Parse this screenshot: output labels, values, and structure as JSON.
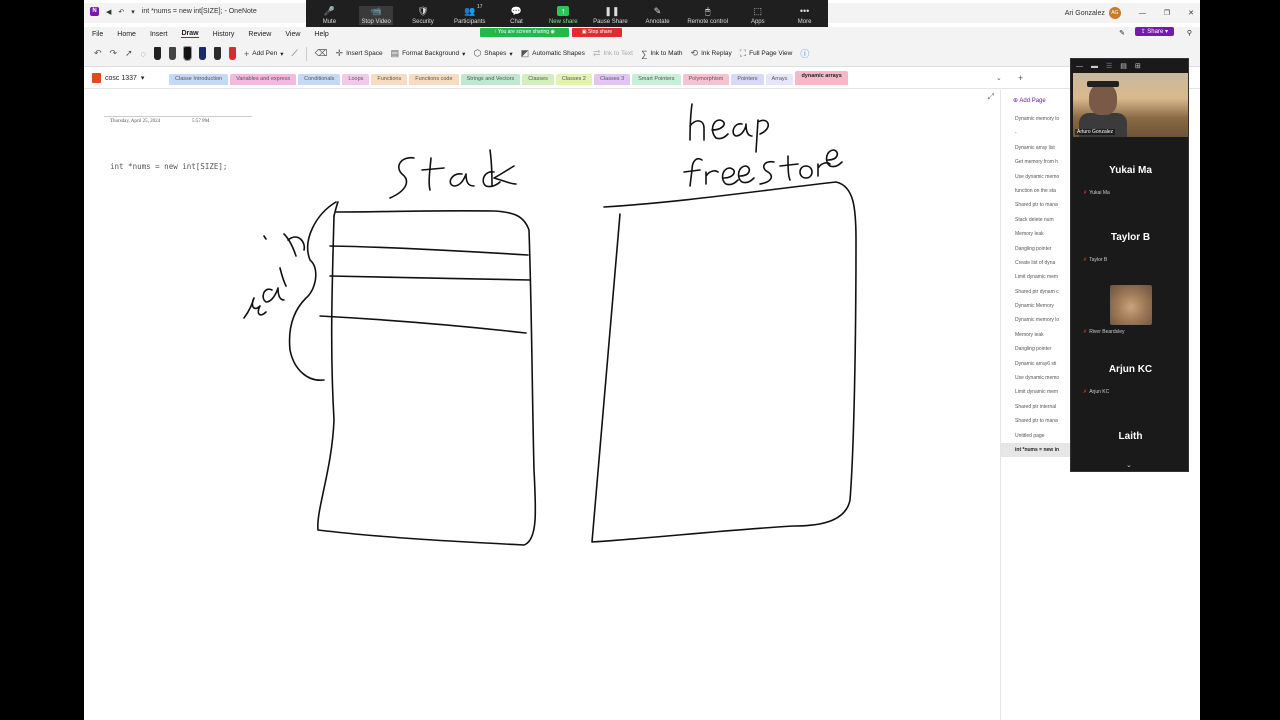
{
  "titlebar": {
    "doc_title": "int *nums = new int[SIZE]; - OneNote",
    "user_name": "Ari Gonzalez",
    "user_initials": "AG"
  },
  "zoom": {
    "items": [
      {
        "label": "Mute",
        "icon": "🎤"
      },
      {
        "label": "Stop Video",
        "icon": "📹"
      },
      {
        "label": "Security",
        "icon": "🛡"
      },
      {
        "label": "Participants",
        "icon": "👥",
        "count": "17"
      },
      {
        "label": "Chat",
        "icon": "💬"
      },
      {
        "label": "New share",
        "icon": "↑"
      },
      {
        "label": "Pause Share",
        "icon": "❚❚"
      },
      {
        "label": "Annotate",
        "icon": "✎"
      },
      {
        "label": "Remote control",
        "icon": "🖱"
      },
      {
        "label": "Apps",
        "icon": "⬚"
      },
      {
        "label": "More",
        "icon": "•••"
      }
    ],
    "banner_sharing": "You are screen sharing",
    "banner_stop": "Stop share"
  },
  "menu": {
    "items": [
      "File",
      "Home",
      "Insert",
      "Draw",
      "History",
      "Review",
      "View",
      "Help"
    ],
    "active": "Draw",
    "share_label": "Share"
  },
  "ribbon": {
    "add_pen": "Add Pen",
    "insert_space": "Insert Space",
    "format_background": "Format Background",
    "shapes": "Shapes",
    "automatic_shapes": "Automatic Shapes",
    "ink_to_text": "Ink to Text",
    "ink_to_math": "Ink to Math",
    "ink_replay": "Ink Replay",
    "full_page_view": "Full Page View"
  },
  "notebook": {
    "name": "cosc 1337"
  },
  "tabs": [
    {
      "label": "Classe Introduction",
      "color": "#c5d8f5"
    },
    {
      "label": "Variables and express",
      "color": "#f2b8e0"
    },
    {
      "label": "Conditionals",
      "color": "#c5d8f5"
    },
    {
      "label": "Loops",
      "color": "#f2c9e8"
    },
    {
      "label": "Functions",
      "color": "#f7dcc2"
    },
    {
      "label": "Functions code",
      "color": "#f7dcc2"
    },
    {
      "label": "Strings and Vectors",
      "color": "#bfe9cf"
    },
    {
      "label": "Classes",
      "color": "#d4efbf"
    },
    {
      "label": "Classes 2",
      "color": "#e4f2b4"
    },
    {
      "label": "Classes 3",
      "color": "#e3c5f5"
    },
    {
      "label": "Smart Pointers",
      "color": "#c8efd8"
    },
    {
      "label": "Polymorphism",
      "color": "#f5c2d2"
    },
    {
      "label": "Pointers",
      "color": "#d6d9f7"
    },
    {
      "label": "Arrays",
      "color": "#e6e6f7"
    },
    {
      "label": "dynamic arrays",
      "color": "#f4b8c8"
    }
  ],
  "page": {
    "date": "Thursday, April 25, 2024",
    "time": "5:57 PM",
    "code": "int *nums = new int[SIZE];",
    "ink_labels": {
      "stack": "Stack",
      "heap": "heap",
      "free_store": "free store",
      "main": "main"
    }
  },
  "pages_panel": {
    "add_page": "Add Page",
    "pages": [
      "Dynamic memory lo",
      "-",
      "Dynamic array list",
      "Get memory from h",
      "Use dynamic memo",
      "function on the sta",
      "Shared ptr to mana",
      "Stack delete num",
      "Memory leak",
      "Dangling pointer",
      "Create list of dyna",
      "Limit dynamic mem",
      "Shared ptr dynam c",
      "Dynamic Memory",
      "Dynamic memory lo",
      "Memory leak",
      "Dangling pointer",
      "Dynamic array6 sti",
      "Use dynamic memo",
      "Limit dynamic mem",
      "Shared ptr internal",
      "Shared ptr to mana",
      "Untitled page",
      "int *nums = new in"
    ],
    "active_index": 23
  },
  "gallery": {
    "video_name": "Arturo Gonzalez",
    "participants": [
      {
        "display": "Yukai Ma",
        "small": "Yukai Ma"
      },
      {
        "display": "Taylor B",
        "small": "Taylor B"
      },
      {
        "display": "",
        "small": "River Beardsley",
        "has_photo": true
      },
      {
        "display": "Arjun KC",
        "small": "Arjun KC"
      },
      {
        "display": "Laith",
        "small": ""
      }
    ]
  }
}
